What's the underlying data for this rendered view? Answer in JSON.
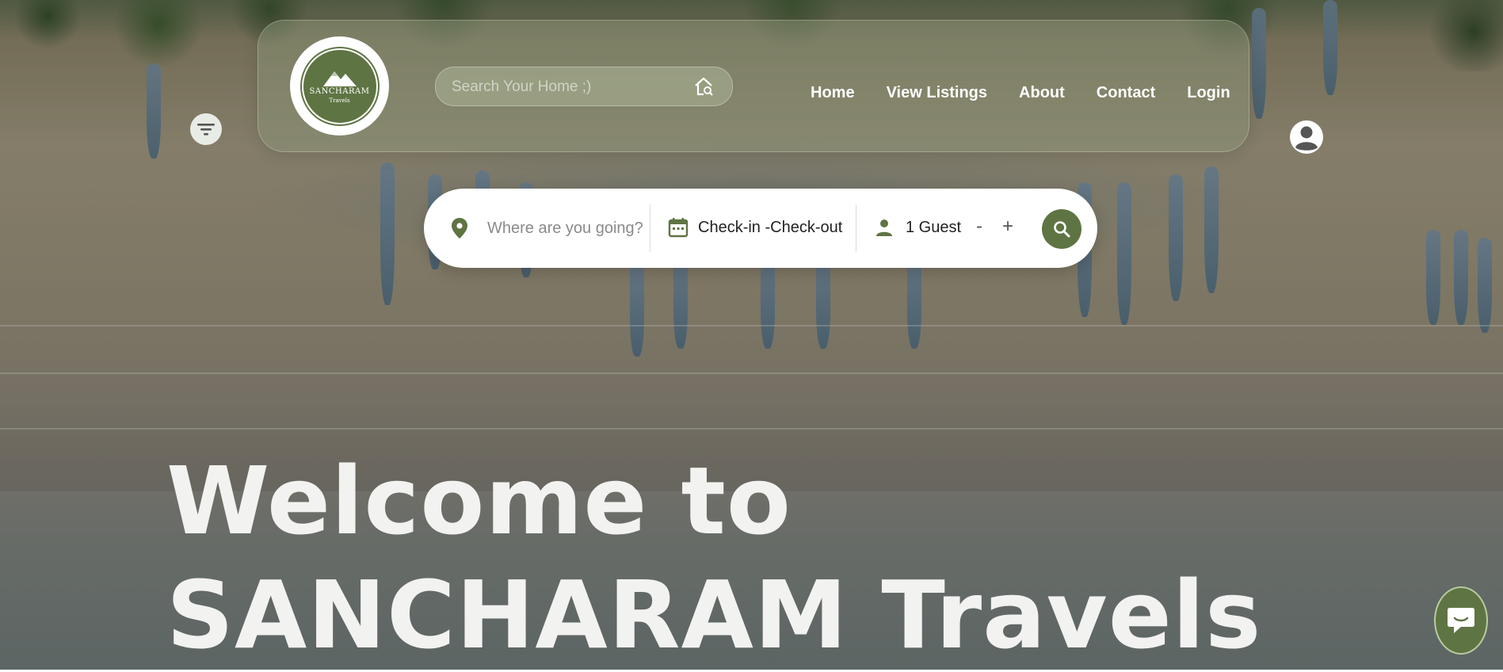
{
  "header": {
    "logo": {
      "brand": "SANCHARAM",
      "sub": "Travels"
    },
    "search": {
      "placeholder": "Search Your Home ;)"
    },
    "nav": [
      "Home",
      "View Listings",
      "About",
      "Contact",
      "Login"
    ]
  },
  "booking": {
    "destination_placeholder": "Where are you going?",
    "dates_label": "Check-in -Check-out",
    "guests_label": "1 Guest",
    "decrement": "-",
    "increment": "+"
  },
  "hero": {
    "line1": "Welcome to",
    "line2": "SANCHARAM Travels"
  },
  "colors": {
    "accent": "#5f7443",
    "header_glass": "rgba(140,150,120,0.45)",
    "nav_text": "#ffffff"
  },
  "icons": {
    "filter": "filter-icon",
    "home_search": "home-search-icon",
    "user": "user-circle-icon",
    "location": "location-pin-icon",
    "calendar": "calendar-icon",
    "person": "person-icon",
    "search": "search-icon",
    "chat": "chat-icon"
  }
}
